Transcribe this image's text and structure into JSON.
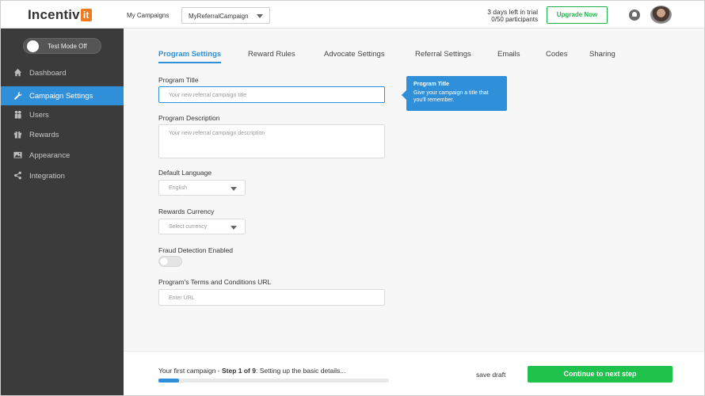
{
  "header": {
    "logo_text": "Incentiv",
    "logo_badge": "it",
    "my_campaigns_label": "My Campaigns",
    "campaign_select_value": "MyReferralCampaign",
    "trial_line1": "3 days left in trial",
    "trial_line2": "0/50 participants",
    "upgrade_label": "Upgrade Now"
  },
  "sidebar": {
    "test_mode_label": "Test Mode Off",
    "items": [
      {
        "label": "Dashboard",
        "icon": "home-icon"
      },
      {
        "label": "Campaign Settings",
        "icon": "wrench-icon"
      },
      {
        "label": "Users",
        "icon": "users-icon"
      },
      {
        "label": "Rewards",
        "icon": "gift-icon"
      },
      {
        "label": "Appearance",
        "icon": "image-icon"
      },
      {
        "label": "Integration",
        "icon": "share-icon"
      }
    ]
  },
  "tabs": [
    {
      "label": "Program Settings",
      "active": true
    },
    {
      "label": "Reward Rules"
    },
    {
      "label": "Advocate Settings"
    },
    {
      "label": "Referral Settings"
    },
    {
      "label": "Emails"
    },
    {
      "label": "Codes"
    },
    {
      "label": "Sharing"
    }
  ],
  "form": {
    "program_title_label": "Program Title",
    "program_title_placeholder": "Your new referral campaign title",
    "program_description_label": "Program Description",
    "program_description_placeholder": "Your new referral campaign description",
    "default_language_label": "Default Language",
    "default_language_value": "English",
    "rewards_currency_label": "Rewards Currency",
    "rewards_currency_value": "Select currency",
    "fraud_detection_label": "Fraud Detection Enabled",
    "terms_url_label": "Program's Terms and Conditions URL",
    "terms_url_placeholder": "Enter URL"
  },
  "tooltip": {
    "title": "Program Title",
    "body": "Give your campaign a title that you'll remember."
  },
  "footer": {
    "step_prefix": "Your first campaign - ",
    "step_bold": "Step 1 of 9",
    "step_suffix": ": Setting up the basic details...",
    "progress": 0.09,
    "save_draft_label": "save draft",
    "continue_label": "Continue to next step"
  },
  "colors": {
    "accent": "#2f8fd9",
    "sidebar_bg": "#3b3b3b",
    "success": "#1fc24a",
    "brand_orange": "#f07a1e"
  }
}
